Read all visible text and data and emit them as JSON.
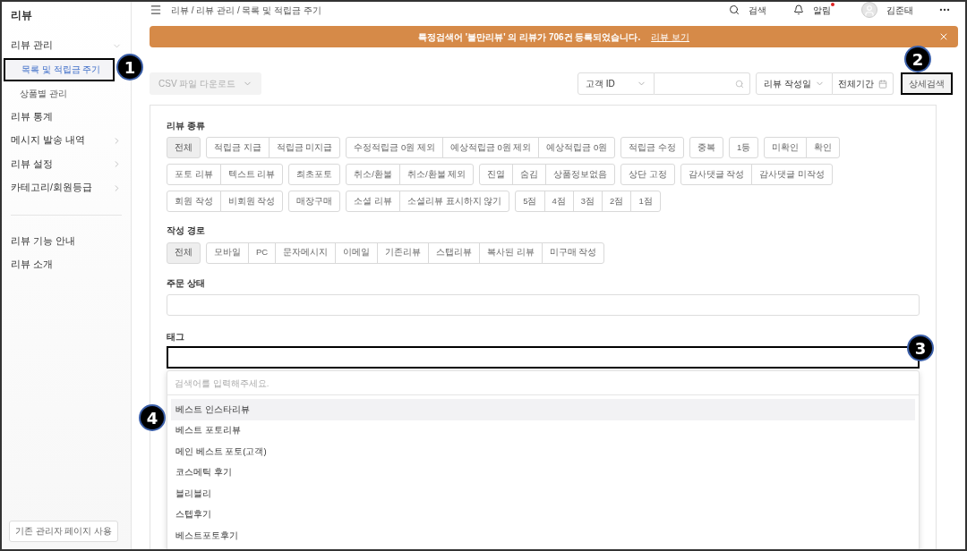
{
  "sidebar": {
    "title": "리뷰",
    "items": [
      {
        "label": "리뷰 관리",
        "selected": false,
        "expanded": true,
        "children": [
          {
            "label": "목록 및 적립금 주기",
            "selected": true
          },
          {
            "label": "상품별 관리",
            "selected": false
          }
        ]
      },
      {
        "label": "리뷰 통계",
        "selected": false
      },
      {
        "label": "메시지 발송 내역",
        "selected": false,
        "expanded": false
      },
      {
        "label": "리뷰 설정",
        "selected": false,
        "expanded": false
      },
      {
        "label": "카테고리/회원등급",
        "selected": false,
        "expanded": false
      }
    ],
    "links": [
      "리뷰 기능 안내",
      "리뷰 소개"
    ],
    "footer_button": "기존 관리자 페이지 사용"
  },
  "header": {
    "breadcrumb": "리뷰 / 리뷰 관리 / 목록 및 적립금 주기",
    "search": "검색",
    "alerts": "알림",
    "alerts_unread": true,
    "user": "김준태"
  },
  "banner": {
    "message": "특정검색어 '불만리뷰' 의 리뷰가 706건 등록되었습니다.",
    "link": "리뷰 보기"
  },
  "toolbar": {
    "csv": "CSV 파일 다운로드",
    "id_select": "고객 ID",
    "date_select": "리뷰 작성일",
    "period": "전체기간",
    "detail_search": "상세검색"
  },
  "filters": {
    "review_type": {
      "label": "리뷰 종류",
      "groups": [
        [
          {
            "label": "전체",
            "selected": true
          }
        ],
        [
          {
            "label": "적립금 지급",
            "selected": false
          },
          {
            "label": "적립금 미지급",
            "selected": false
          }
        ],
        [
          {
            "label": "수정적립금 0원 제외",
            "selected": false
          },
          {
            "label": "예상적립금 0원 제외",
            "selected": false
          },
          {
            "label": "예상적립금 0원",
            "selected": false
          }
        ],
        [
          {
            "label": "적립금 수정",
            "selected": false
          }
        ],
        [
          {
            "label": "중복",
            "selected": false
          }
        ],
        [
          {
            "label": "1등",
            "selected": false
          }
        ],
        [
          {
            "label": "미확인",
            "selected": false
          },
          {
            "label": "확인",
            "selected": false
          }
        ],
        [
          {
            "label": "포토 리뷰",
            "selected": false
          },
          {
            "label": "텍스트 리뷰",
            "selected": false
          }
        ],
        [
          {
            "label": "최초포토",
            "selected": false
          }
        ],
        [
          {
            "label": "취소/환불",
            "selected": false
          },
          {
            "label": "취소/환불 제외",
            "selected": false
          }
        ],
        [
          {
            "label": "진열",
            "selected": false
          },
          {
            "label": "숨김",
            "selected": false
          },
          {
            "label": "상품정보없음",
            "selected": false
          }
        ],
        [
          {
            "label": "상단 고정",
            "selected": false
          }
        ],
        [
          {
            "label": "감사댓글 작성",
            "selected": false
          },
          {
            "label": "감사댓글 미작성",
            "selected": false
          }
        ],
        [
          {
            "label": "회원 작성",
            "selected": false
          },
          {
            "label": "비회원 작성",
            "selected": false
          }
        ],
        [
          {
            "label": "매장구매",
            "selected": false
          }
        ],
        [
          {
            "label": "소셜 리뷰",
            "selected": false
          },
          {
            "label": "소셜리뷰 표시하지 않기",
            "selected": false
          }
        ],
        [
          {
            "label": "5점",
            "selected": false
          },
          {
            "label": "4점",
            "selected": false
          },
          {
            "label": "3점",
            "selected": false
          },
          {
            "label": "2점",
            "selected": false
          },
          {
            "label": "1점",
            "selected": false
          }
        ]
      ]
    },
    "source": {
      "label": "작성 경로",
      "groups": [
        [
          {
            "label": "전체",
            "selected": true
          }
        ],
        [
          {
            "label": "모바일",
            "selected": false
          },
          {
            "label": "PC",
            "selected": false
          },
          {
            "label": "문자메시지",
            "selected": false
          },
          {
            "label": "이메일",
            "selected": false
          },
          {
            "label": "기존리뷰",
            "selected": false
          },
          {
            "label": "스탭리뷰",
            "selected": false
          },
          {
            "label": "복사된 리뷰",
            "selected": false
          },
          {
            "label": "미구매 작성",
            "selected": false
          }
        ]
      ]
    },
    "order_status": {
      "label": "주문 상태"
    },
    "tag": {
      "label": "태그",
      "dropdown": {
        "placeholder": "검색어를 입력해주세요.",
        "options": [
          {
            "label": "베스트 인스타리뷰",
            "selected": true
          },
          {
            "label": "베스트 포토리뷰",
            "selected": false
          },
          {
            "label": "메인 베스트 포토(고객)",
            "selected": false
          },
          {
            "label": "코스메틱 후기",
            "selected": false
          },
          {
            "label": "블리블리",
            "selected": false
          },
          {
            "label": "스텝후기",
            "selected": false
          },
          {
            "label": "베스트포토후기",
            "selected": false
          }
        ]
      }
    }
  },
  "annotations": [
    "1",
    "2",
    "3",
    "4"
  ]
}
